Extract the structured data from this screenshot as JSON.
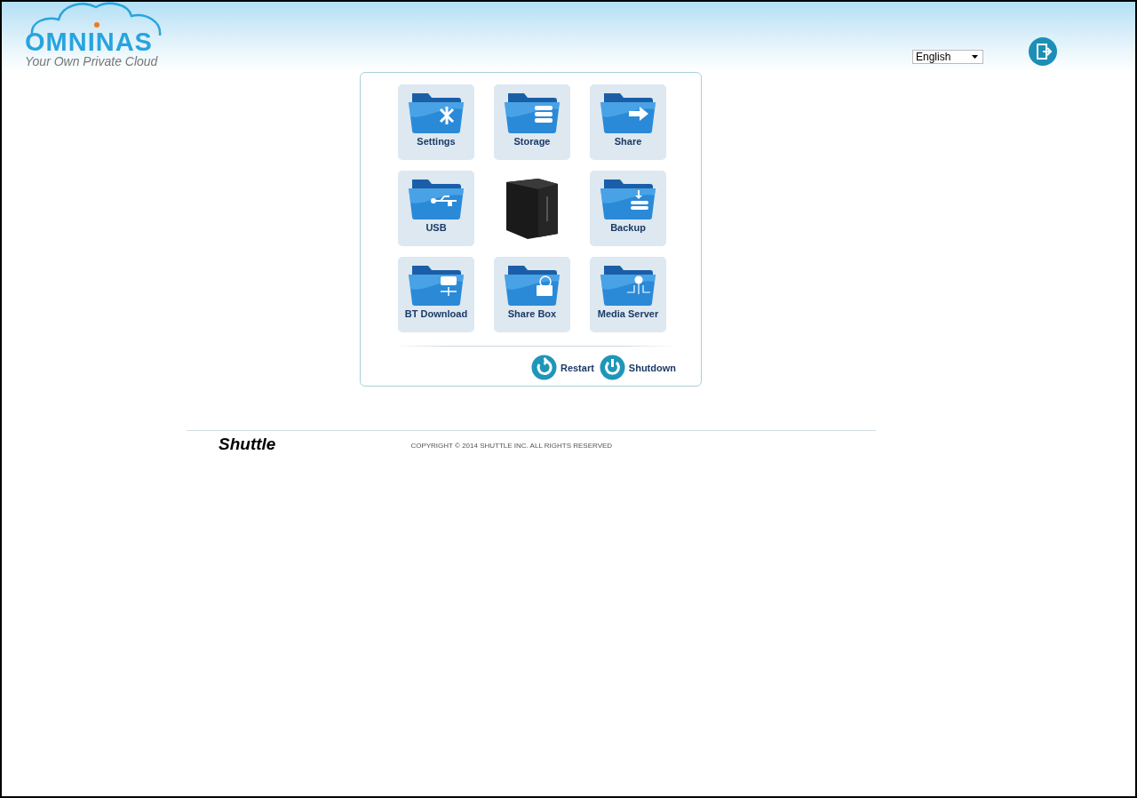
{
  "header": {
    "logo": "OMNINAS",
    "tagline": "Your Own Private Cloud",
    "language": {
      "value": "English"
    }
  },
  "apps": [
    {
      "kind": "folder",
      "label": "Settings"
    },
    {
      "kind": "folder",
      "label": "Storage"
    },
    {
      "kind": "folder",
      "label": "Share"
    },
    {
      "kind": "folder",
      "label": "USB"
    },
    {
      "kind": "device"
    },
    {
      "kind": "folder",
      "label": "Backup"
    },
    {
      "kind": "folder",
      "label": "BT Download"
    },
    {
      "kind": "folder",
      "label": "Share Box"
    },
    {
      "kind": "folder",
      "label": "Media Server"
    }
  ],
  "power": [
    {
      "kind": "restart",
      "label": "Restart"
    },
    {
      "kind": "shutdown",
      "label": "Shutdown"
    }
  ],
  "footer": {
    "brand": "Shuttle",
    "copyright": "COPYRIGHT © 2014 SHUTTLE INC. ALL RIGHTS RESERVED"
  }
}
